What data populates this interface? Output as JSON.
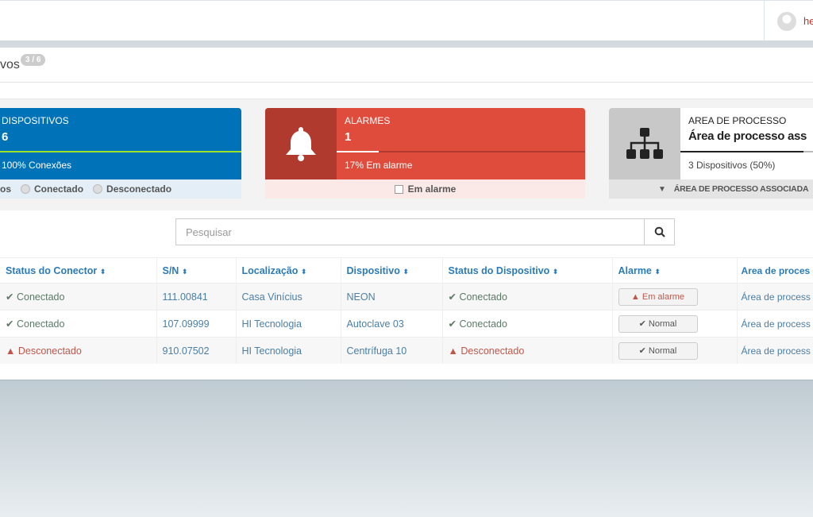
{
  "header": {
    "username": "he"
  },
  "page": {
    "title": "vos",
    "badge": "3 / 6"
  },
  "cards": {
    "devices": {
      "label": "DISPOSITIVOS",
      "value": "6",
      "sub": "100% Conexões",
      "progress_percent": 100,
      "filters": [
        "os",
        "Conectado",
        "Desconectado"
      ],
      "color": "#0072b8"
    },
    "alarms": {
      "label": "ALARMES",
      "value": "1",
      "sub": "17% Em alarme",
      "progress_percent": 17,
      "filter": "Em alarme",
      "color": "#e04c3c"
    },
    "area": {
      "label": "AREA DE PROCESSO",
      "value": "Área de processo ass",
      "sub": "3 Dispositivos (50%)",
      "progress_percent": 50,
      "filter": "ÁREA DE PROCESSO ASSOCIADA"
    }
  },
  "search": {
    "placeholder": "Pesquisar"
  },
  "table": {
    "headers": [
      "Status do Conector",
      "S/N",
      "Localização",
      "Dispositivo",
      "Status do Dispositivo",
      "Alarme",
      "Area de proces"
    ],
    "rows": [
      {
        "connector": "Conectado",
        "connector_ok": true,
        "sn": "111.00841",
        "location": "Casa Vinícius",
        "device": "NEON",
        "device_status": "Conectado",
        "device_ok": true,
        "alarm": "Em alarme",
        "alarm_on": true,
        "area": "Área de process"
      },
      {
        "connector": "Conectado",
        "connector_ok": true,
        "sn": "107.09999",
        "location": "HI Tecnologia",
        "device": "Autoclave 03",
        "device_status": "Conectado",
        "device_ok": true,
        "alarm": "Normal",
        "alarm_on": false,
        "area": "Área de process"
      },
      {
        "connector": "Desconectado",
        "connector_ok": false,
        "sn": "910.07502",
        "location": "HI Tecnologia",
        "device": "Centrífuga 10",
        "device_status": "Desconectado",
        "device_ok": false,
        "alarm": "Normal",
        "alarm_on": false,
        "area": "Área de process"
      }
    ]
  }
}
